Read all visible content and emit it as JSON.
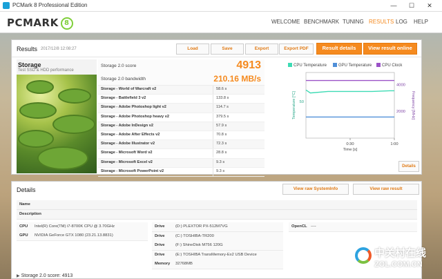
{
  "window": {
    "title": "PCMark 8 Professional Edition",
    "controls": {
      "minimize": "—",
      "maximize": "☐",
      "close": "✕"
    }
  },
  "header": {
    "logo": "PCMARK",
    "logo_badge": "8",
    "nav": [
      "WELCOME",
      "BENCHMARK",
      "TUNING",
      "RESULTS",
      "LOG",
      "HELP"
    ],
    "active_nav": "RESULTS",
    "accent_color": "#f58a1f"
  },
  "results": {
    "title": "Results",
    "timestamp": "2017/12/8 12:08:27",
    "buttons": {
      "load": "Load",
      "save": "Save",
      "export": "Export",
      "export_pdf": "Export PDF",
      "result_details": "Result details",
      "view_online": "View result online"
    },
    "test": {
      "name": "Storage",
      "description": "Test SSD & HDD performance"
    },
    "score_label": "Storage 2.0 score",
    "score_value": "4913",
    "bandwidth_label": "Storage 2.0 bandwidth",
    "bandwidth_value": "210.16 MB/s",
    "subtests": [
      {
        "name": "Storage - World of Warcraft v2",
        "value": "58.6 s"
      },
      {
        "name": "Storage - Battlefield 3 v2",
        "value": "133.8 s"
      },
      {
        "name": "Storage - Adobe Photoshop light v2",
        "value": "114.7 s"
      },
      {
        "name": "Storage - Adobe Photoshop heavy v2",
        "value": "379.5 s"
      },
      {
        "name": "Storage - Adobe InDesign v2",
        "value": "57.9 s"
      },
      {
        "name": "Storage - Adobe After Effects v2",
        "value": "70.8 s"
      },
      {
        "name": "Storage - Adobe Illustrator v2",
        "value": "72.3 s"
      },
      {
        "name": "Storage - Microsoft Word v2",
        "value": "28.8 s"
      },
      {
        "name": "Storage - Microsoft Excel v2",
        "value": "9.3 s"
      },
      {
        "name": "Storage - Microsoft PowerPoint v2",
        "value": "9.3 s"
      }
    ],
    "details_button": "Details"
  },
  "chart_data": {
    "type": "line",
    "series": [
      {
        "name": "CPU Temperature",
        "color": "#3ddbb4",
        "axis": "left",
        "x": [
          0,
          0.05,
          0.25,
          0.5,
          0.75,
          0.95,
          1.0
        ],
        "values": [
          66,
          62,
          64,
          64,
          64,
          65,
          65
        ]
      },
      {
        "name": "GPU Temperature",
        "color": "#4f8fd8",
        "axis": "left",
        "x": [
          0,
          0.25,
          0.5,
          0.75,
          1.0
        ],
        "values": [
          29,
          29,
          29,
          29,
          29
        ]
      },
      {
        "name": "CPU Clock",
        "color": "#9b52c7",
        "axis": "right",
        "x": [
          0,
          0.05,
          0.5,
          1.0
        ],
        "values": [
          4300,
          4300,
          4300,
          4300
        ]
      }
    ],
    "xlabel": "Time [s]",
    "x_ticks": [
      "0:30",
      "1:00"
    ],
    "x_tick_values": [
      0.5,
      1.0
    ],
    "xlim": [
      0,
      1.0
    ],
    "ylabel_left": "Temperature [°C]",
    "ylabel_right": "Frequency [MHz]",
    "yticks_left": [
      50
    ],
    "yticks_right": [
      2000,
      4000
    ],
    "ylim_left": [
      0,
      90
    ],
    "ylim_right": [
      0,
      4900
    ],
    "legend_position": "top"
  },
  "details": {
    "title": "Details",
    "buttons": {
      "view_sysinfo": "View raw SystemInfo",
      "view_raw": "View raw result"
    },
    "name_label": "Name",
    "description_label": "Description",
    "cpu_label": "CPU",
    "cpu_value": "Intel(R) Core(TM) i7-8700K CPU @ 3.70GHz",
    "gpu_label": "GPU",
    "gpu_value": "NVIDIA GeForce GTX 1080 (23.21.13.8831)",
    "drives": [
      {
        "label": "Drive",
        "value": "(D:) PLEXTOR PX-512M7VG"
      },
      {
        "label": "Drive",
        "value": "(C:) TOSHIBA-TR200"
      },
      {
        "label": "Drive",
        "value": "(F:) ShineDisk M756 120G"
      },
      {
        "label": "Drive",
        "value": "(E:) TOSHIBA TransMemory-Ex2 USB Device"
      }
    ],
    "memory_label": "Memory",
    "memory_value": "32768MB",
    "opencl_label": "OpenCL",
    "opencl_value": "----",
    "footer": "Storage 2.0 score: 4913",
    "footer_arrow": "▶"
  },
  "watermark": {
    "cn": "中关村在线",
    "en": "ZOL.COM.CN"
  }
}
